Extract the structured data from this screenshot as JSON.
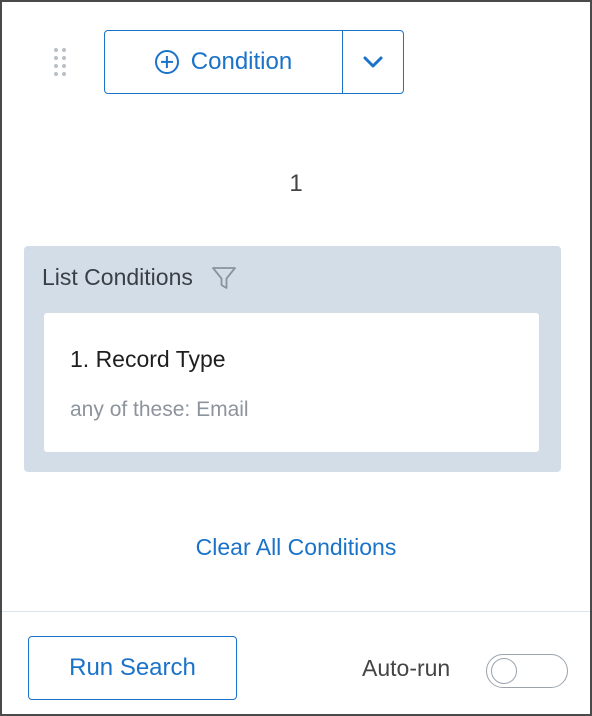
{
  "condition_button": {
    "label": "Condition",
    "icon": "plus-circle-icon",
    "dropdown_icon": "chevron-down-icon"
  },
  "condition_count": "1",
  "list_conditions": {
    "title": "List Conditions",
    "icon": "filter-icon",
    "items": [
      {
        "title": "1. Record Type",
        "summary": "any of these: Email"
      }
    ]
  },
  "clear_all_label": "Clear All Conditions",
  "footer": {
    "run_search_label": "Run Search",
    "auto_run_label": "Auto-run",
    "auto_run_enabled": false
  },
  "colors": {
    "accent": "#1a73c8",
    "list_background": "#d3dde8",
    "muted_text": "#8d949c"
  }
}
